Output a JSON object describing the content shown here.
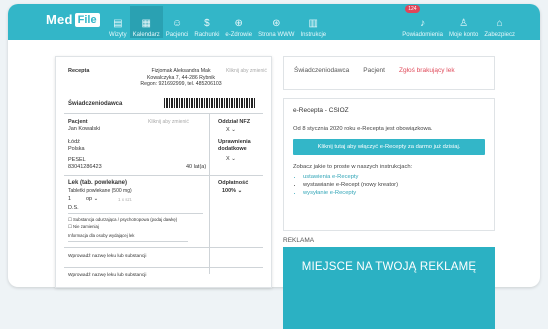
{
  "topbar": {
    "logo_left": "Med",
    "logo_right": "File",
    "nav": [
      {
        "label": "Wizyty",
        "icon": "calendar-icon",
        "glyph": "▤"
      },
      {
        "label": "Kalendarz",
        "icon": "grid-calendar-icon",
        "glyph": "▦"
      },
      {
        "label": "Pacjenci",
        "icon": "patients-icon",
        "glyph": "☺"
      },
      {
        "label": "Rachunki",
        "icon": "dollar-icon",
        "glyph": "$"
      },
      {
        "label": "e-Zdrowie",
        "icon": "health-icon",
        "glyph": "⊕"
      },
      {
        "label": "Strona WWW",
        "icon": "globe-icon",
        "glyph": "⊛"
      },
      {
        "label": "Instrukcje",
        "icon": "document-icon",
        "glyph": "▥"
      }
    ],
    "right": [
      {
        "label": "Powiadomienia",
        "icon": "bell-icon",
        "glyph": "♪",
        "badge": "124"
      },
      {
        "label": "Moje konto",
        "icon": "user-icon",
        "glyph": "♙"
      },
      {
        "label": "Zabezpiecz",
        "icon": "lock-icon",
        "glyph": "⌂"
      }
    ]
  },
  "recepta": {
    "heading": "Recepta",
    "clinic_name": "Fizjomak Aleksandra Mak",
    "clinic_address": "Kowalczyka 7, 44-286 Rybnik",
    "clinic_regon": "Regon: 921692999, tel. 485206103",
    "click_edit": "Kliknij aby zmienić",
    "provider_label": "Świadczeniodawca",
    "patient_label": "Pacjent",
    "patient_name": "Jan Kowalski",
    "patient_city": "Łódź",
    "patient_country": "Polska",
    "pesel_label": "PESEL",
    "pesel": "83041286423",
    "age": "40 lat(a)",
    "oddzial_label": "Oddział NFZ",
    "oddzial_value": "X",
    "uprawnienia_label": "Uprawnienia dodatkowe",
    "uprawnienia_value": "X",
    "drug_name": "Lek (tab. powlekane)",
    "drug_desc": "Tabletki powlekane (500 mg)",
    "qty": "1",
    "unit": "op",
    "qty_note": "1 x szt.",
    "dosage": "D.S.",
    "refund_label": "Odpłatność",
    "refund_value": "100%",
    "check1": "Substancja odurzająca / psychotropowa (podaj dawkę)",
    "check2": "Nie zamieniaj",
    "pharmacist_note": "Informacja dla osoby wydającej lek",
    "enter_drug_1": "Wprowadź nazwę leku lub substancji",
    "enter_drug_2": "Wprowadź nazwę leku lub substancji"
  },
  "tabs": [
    "Świadczeniodawca",
    "Pacjent",
    "Zgłoś brakujący lek"
  ],
  "erecepta": {
    "title": "e-Recepta - CSIOZ",
    "intro": "Od 8 stycznia 2020 roku e-Recepta jest obowiązkowa.",
    "button": "Kliknij tutaj aby włączyć e-Recepty za darmo już dzisiaj.",
    "see": "Zobacz jakie to proste w naszych instrukcjach:",
    "links": [
      "ustawienia e-Recepty",
      "wystawianie e-Recept (nowy kreator)",
      "wysyłanie e-Recepty"
    ]
  },
  "ad": {
    "label": "REKLAMA",
    "text": "MIEJSCE NA TWOJĄ REKLAMĘ"
  },
  "colors": {
    "accent": "#33b6c8",
    "warning": "#e04b5b"
  }
}
